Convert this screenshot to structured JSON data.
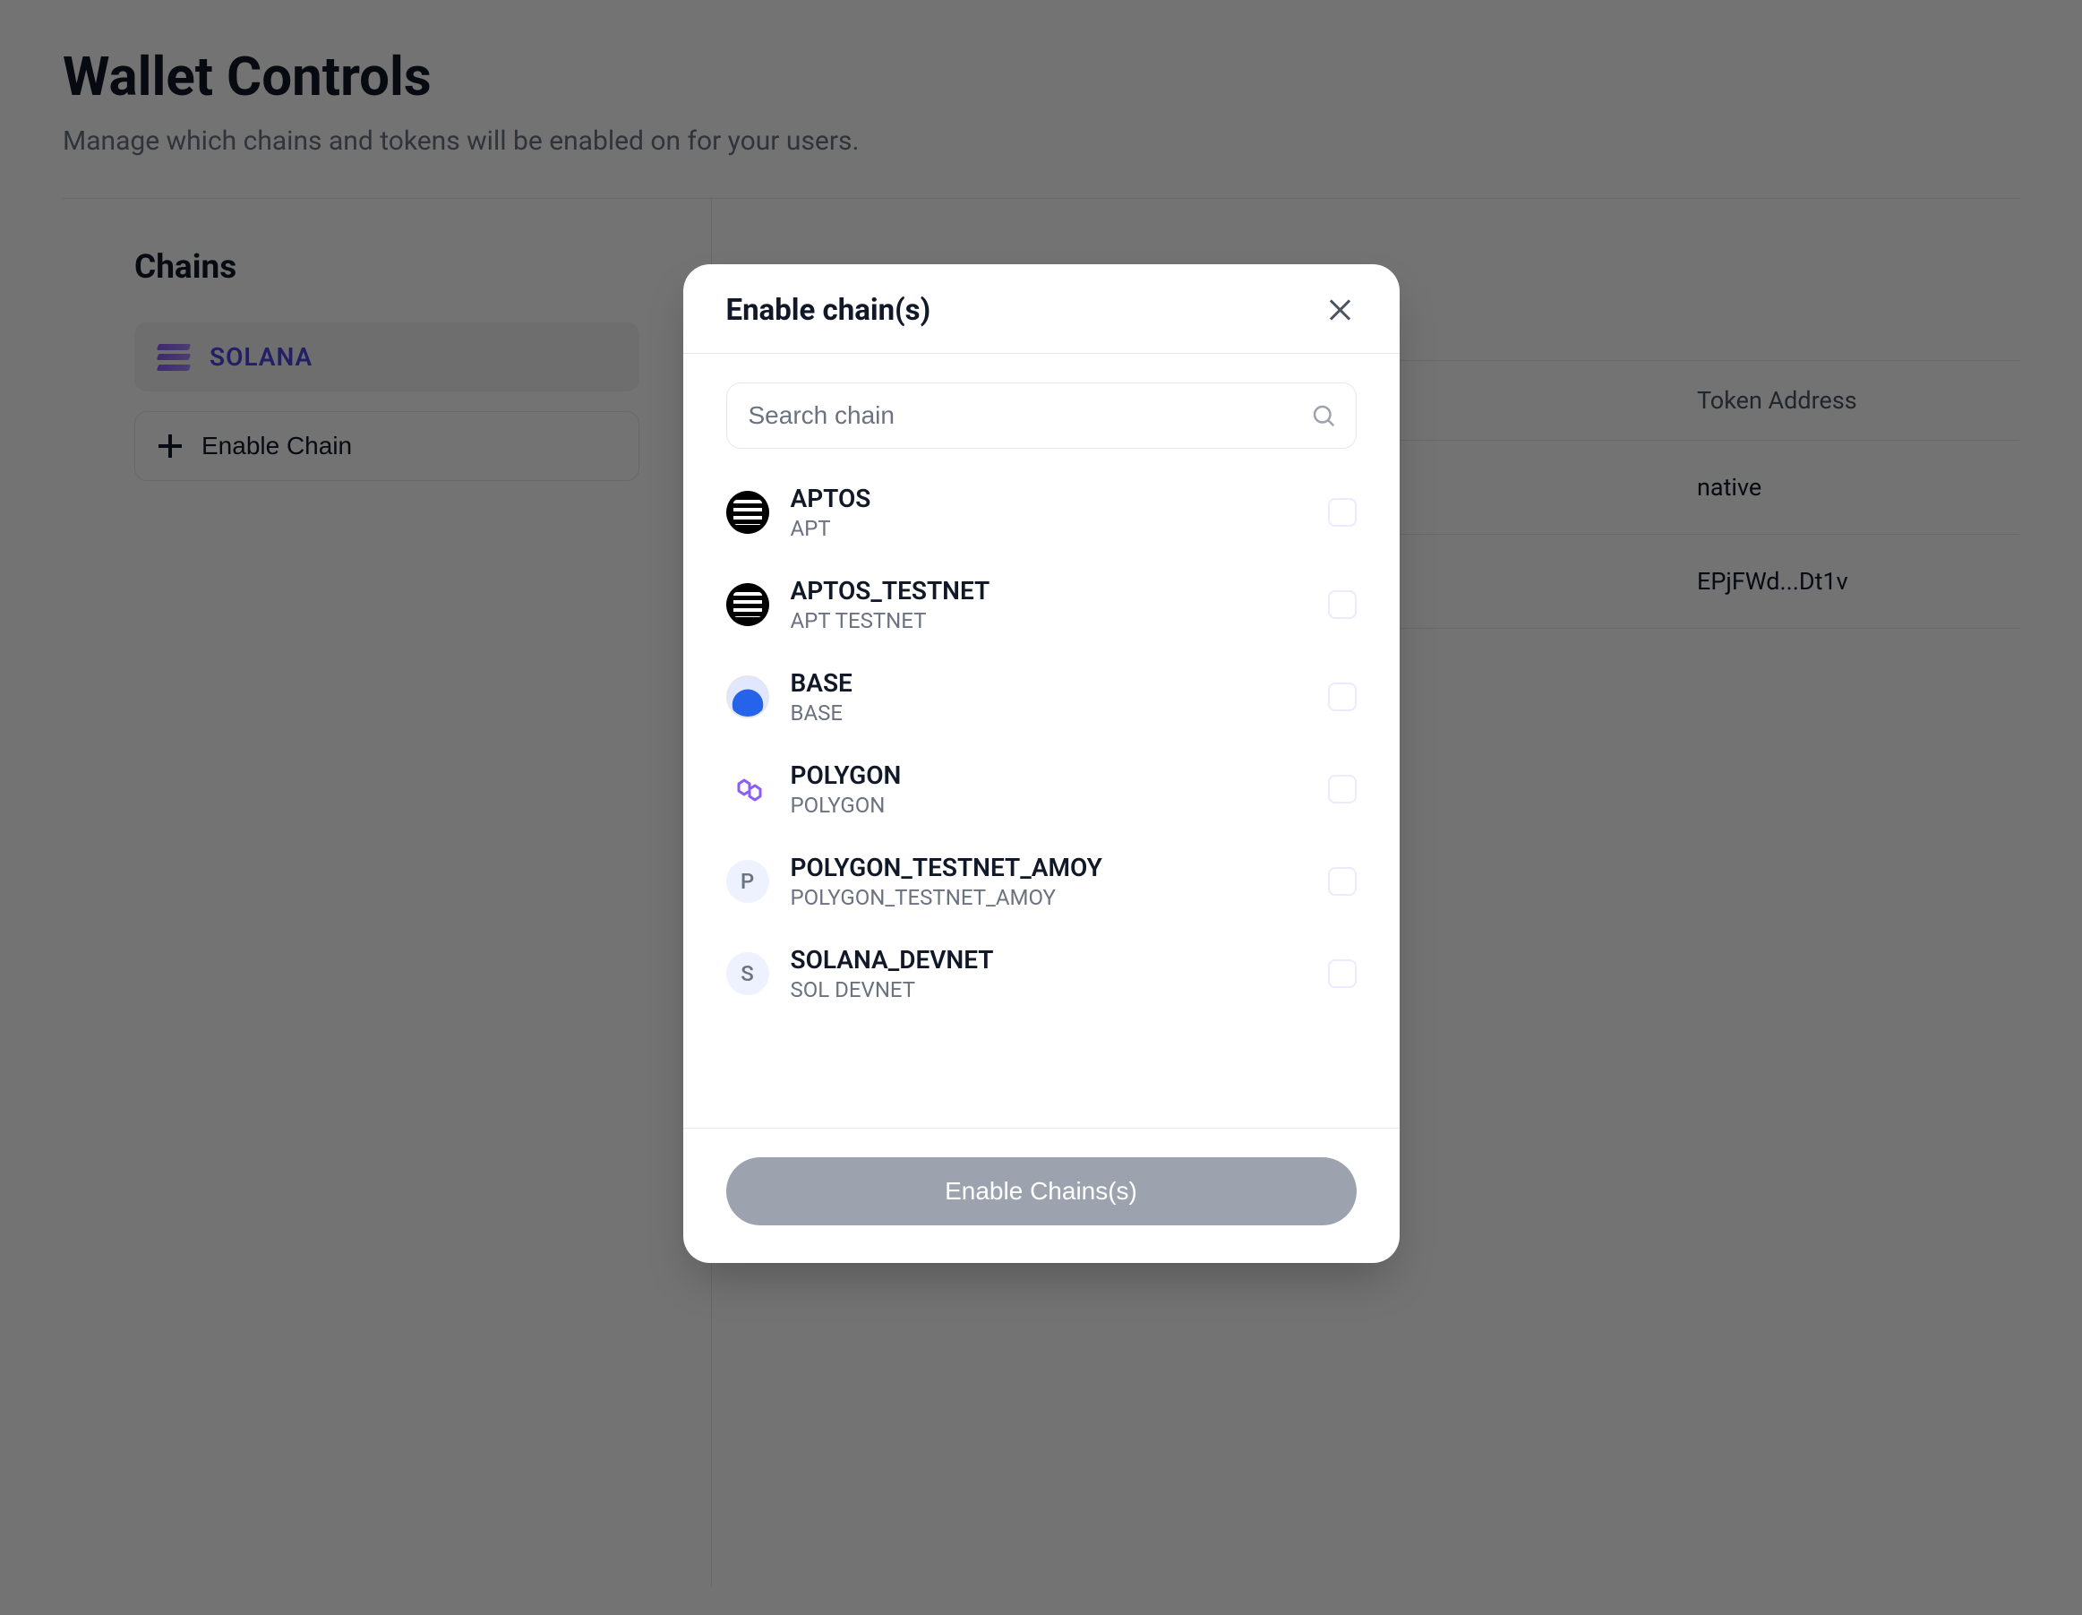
{
  "page": {
    "title": "Wallet Controls",
    "subtitle": "Manage which chains and tokens will be enabled on for your users."
  },
  "sidebar": {
    "heading": "Chains",
    "active_chain_label": "SOLANA",
    "enable_chain_label": "Enable Chain"
  },
  "table": {
    "header_token_address": "Token Address",
    "rows": [
      {
        "address": "native"
      },
      {
        "address": "EPjFWd...Dt1v"
      }
    ]
  },
  "modal": {
    "title": "Enable chain(s)",
    "search_placeholder": "Search chain",
    "submit_label": "Enable Chains(s)",
    "chains": [
      {
        "name": "APTOS",
        "sub": "APT",
        "logo": "aptos"
      },
      {
        "name": "APTOS_TESTNET",
        "sub": "APT TESTNET",
        "logo": "aptos"
      },
      {
        "name": "BASE",
        "sub": "BASE",
        "logo": "base"
      },
      {
        "name": "POLYGON",
        "sub": "POLYGON",
        "logo": "polygon"
      },
      {
        "name": "POLYGON_TESTNET_AMOY",
        "sub": "POLYGON_TESTNET_AMOY",
        "logo": "letter",
        "letter": "P"
      },
      {
        "name": "SOLANA_DEVNET",
        "sub": "SOL DEVNET",
        "logo": "letter",
        "letter": "S"
      }
    ]
  }
}
